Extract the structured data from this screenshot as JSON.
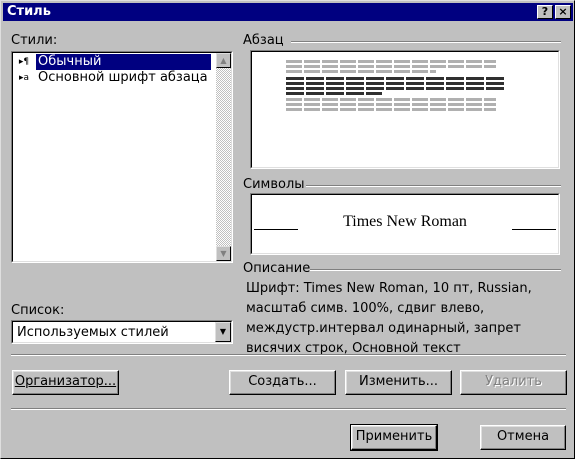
{
  "window": {
    "title": "Стиль",
    "help_button": "?",
    "close_button": "×"
  },
  "styles": {
    "label": "Стили:",
    "items": [
      {
        "label": "Обычный",
        "marker": "¶",
        "selected": true
      },
      {
        "label": "Основной шрифт абзаца",
        "marker": "a"
      }
    ]
  },
  "list": {
    "label": "Список:",
    "value": "Используемых стилей"
  },
  "paragraph": {
    "label": "Абзац"
  },
  "symbols": {
    "label": "Символы",
    "font_sample": "Times New Roman"
  },
  "description": {
    "label": "Описание",
    "text": "Шрифт: Times New Roman, 10 пт, Russian, масштаб симв. 100%, сдвиг влево, междустр.интервал одинарный, запрет висячих строк, Основной текст"
  },
  "buttons": {
    "organizer": "Организатор...",
    "create": "Создать...",
    "modify": "Изменить...",
    "delete": "Удалить",
    "apply": "Применить",
    "cancel": "Отмена"
  }
}
